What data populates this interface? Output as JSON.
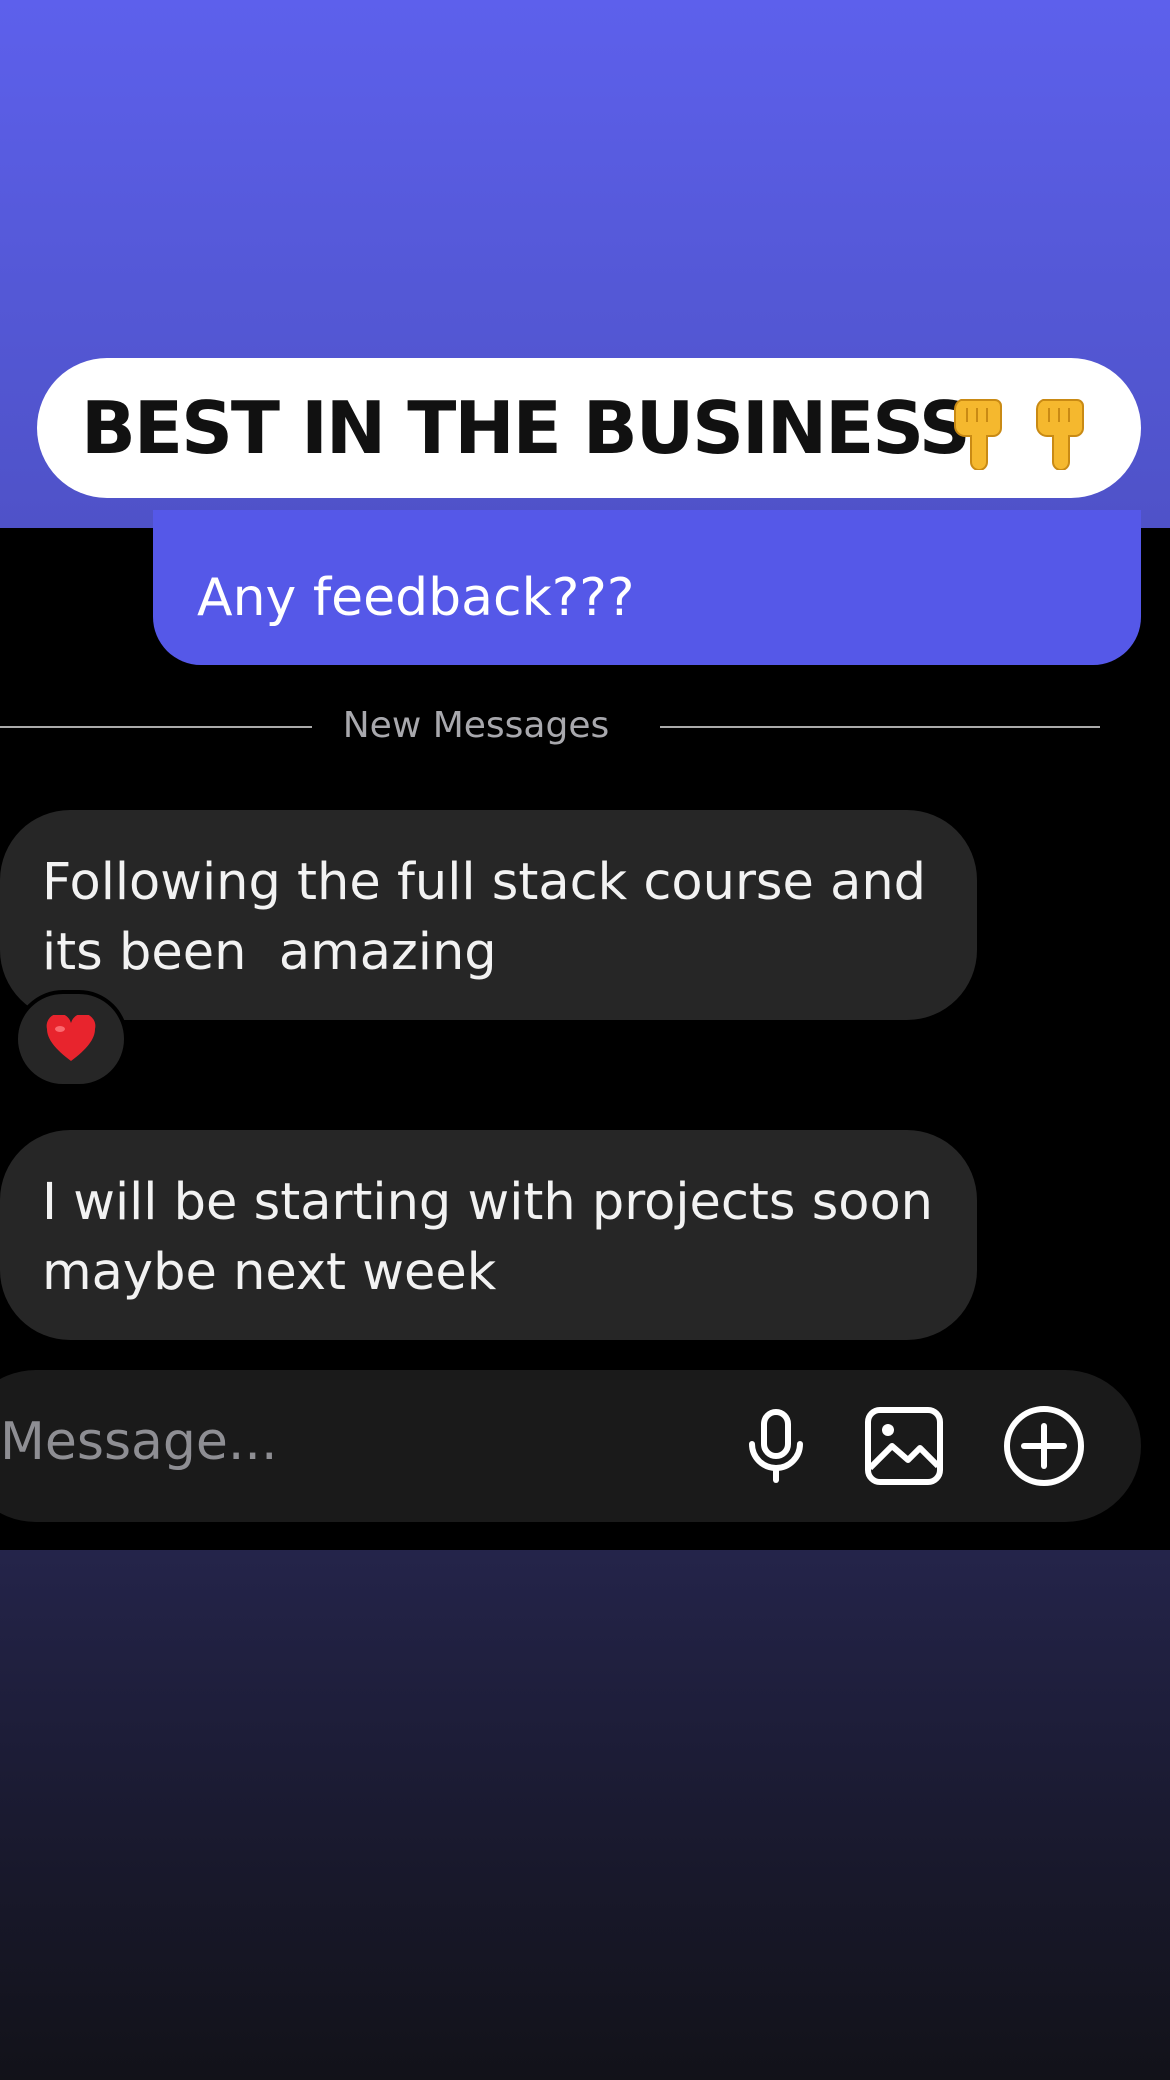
{
  "headline": {
    "text": "BEST IN THE BUSINESS",
    "emoji_icons": [
      "pointing-down-icon",
      "pointing-down-icon"
    ]
  },
  "messages": {
    "sent": [
      {
        "text": "Any feedback???"
      }
    ],
    "divider_label": "New Messages",
    "received": [
      {
        "text": "Following the full stack course and\nits been  amazing",
        "reaction": "heart-icon"
      },
      {
        "text": "I will be starting with projects soon\nmaybe next week"
      }
    ]
  },
  "composer": {
    "placeholder": "Message...",
    "icons": [
      "microphone-icon",
      "image-icon",
      "plus-circle-icon"
    ]
  },
  "colors": {
    "top_gradient": "#5d60ec",
    "sent_bubble": "#5558e8",
    "received_bubble": "#262626",
    "composer": "#1a1a1a",
    "bottom_gradient": "#24244a"
  }
}
